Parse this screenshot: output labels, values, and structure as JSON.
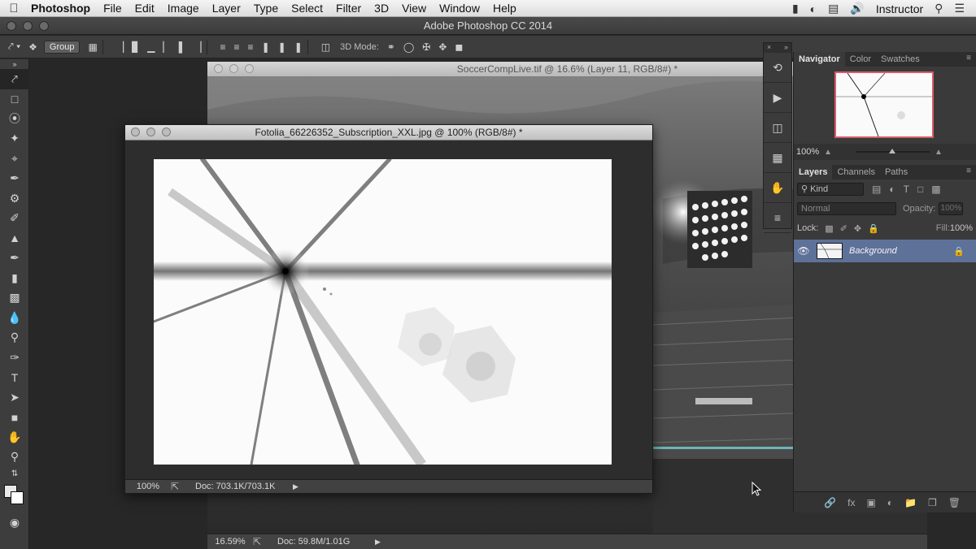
{
  "menubar": {
    "app_name": "Photoshop",
    "items": [
      "File",
      "Edit",
      "Image",
      "Layer",
      "Type",
      "Select",
      "Filter",
      "3D",
      "View",
      "Window",
      "Help"
    ],
    "user": "Instructor"
  },
  "app": {
    "title": "Adobe Photoshop CC 2014"
  },
  "options_bar": {
    "auto_select_target": "Group",
    "mode_label": "3D Mode:"
  },
  "doc_back": {
    "title": "SoccerCompLive.tif @ 16.6% (Layer 11, RGB/8#) *",
    "zoom": "16.59%",
    "doc_info": "Doc: 59.8M/1.01G"
  },
  "doc_front": {
    "title": "Fotolia_66226352_Subscription_XXL.jpg @ 100% (RGB/8#) *",
    "zoom": "100%",
    "doc_info": "Doc: 703.1K/703.1K"
  },
  "navigator": {
    "tabs": [
      "Navigator",
      "Color",
      "Swatches"
    ],
    "active_tab": "Navigator",
    "zoom": "100%"
  },
  "layers": {
    "tabs": [
      "Layers",
      "Channels",
      "Paths"
    ],
    "active_tab": "Layers",
    "filter_kind": "Kind",
    "blend_mode": "Normal",
    "opacity_label": "Opacity:",
    "opacity_value": "100%",
    "lock_label": "Lock:",
    "fill_label": "Fill:",
    "fill_value": "100%",
    "items": [
      {
        "name": "Background",
        "visible": true,
        "locked": true
      }
    ]
  },
  "colors": {
    "accent_selection": "#5d7199",
    "navigator_box": "#d95b6b"
  }
}
